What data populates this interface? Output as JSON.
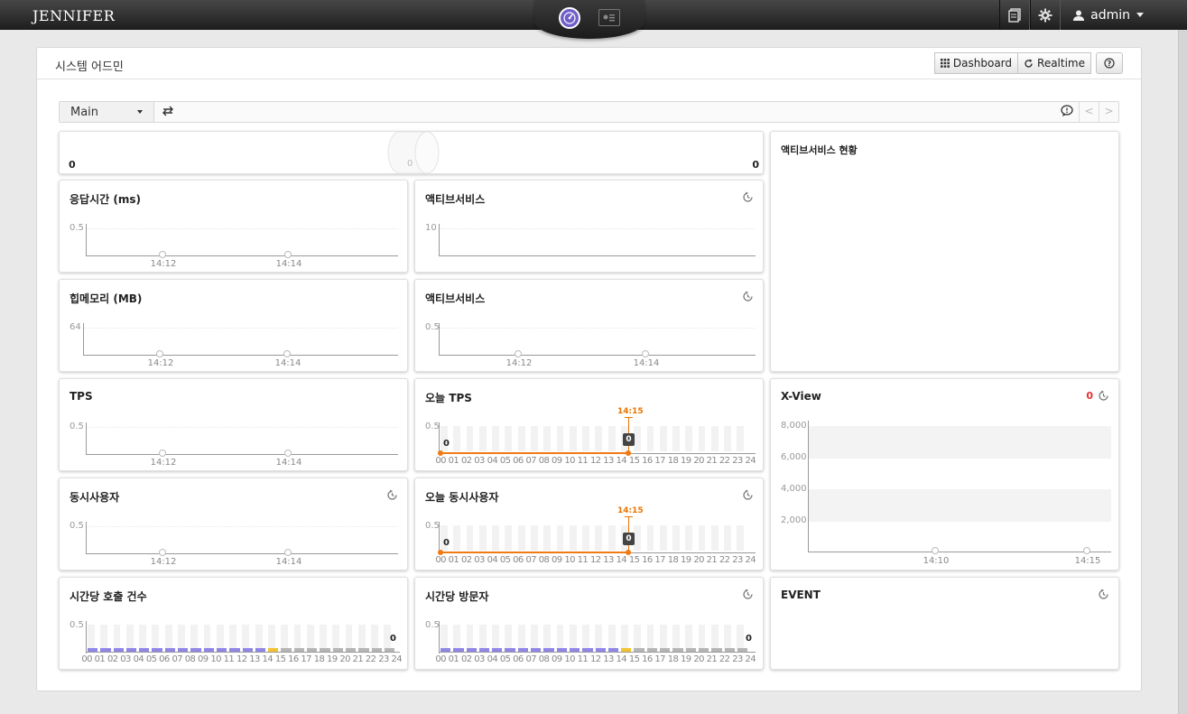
{
  "app": {
    "logo": "JENNIFER",
    "user": "admin"
  },
  "panel": {
    "title": "시스템 어드민",
    "dashboard_label": "Dashboard",
    "realtime_label": "Realtime",
    "help_label": "?"
  },
  "toolbar": {
    "selected": "Main"
  },
  "equalizer": {
    "left_value": "0",
    "right_value": "0",
    "center_value": "0"
  },
  "widgets": {
    "response_time": {
      "title": "응답시간 (ms)",
      "y_max": "0.5",
      "x_ticks": [
        "14:12",
        "14:14"
      ]
    },
    "active_service_1": {
      "title": "액티브서비스",
      "y_max": "10"
    },
    "heap_memory": {
      "title": "힙메모리 (MB)",
      "y_max": "64",
      "x_ticks": [
        "14:12",
        "14:14"
      ]
    },
    "active_service_2": {
      "title": "액티브서비스",
      "y_max": "0.5",
      "x_ticks": [
        "14:12",
        "14:14"
      ]
    },
    "tps": {
      "title": "TPS",
      "y_max": "0.5",
      "x_ticks": [
        "14:12",
        "14:14"
      ]
    },
    "today_tps": {
      "title": "오늘 TPS",
      "y_max": "0.5",
      "marker_time": "14:15",
      "marker_value": "0",
      "start_value": "0"
    },
    "concurrent_users": {
      "title": "동시사용자",
      "y_max": "0.5",
      "x_ticks": [
        "14:12",
        "14:14"
      ]
    },
    "today_concurrent_users": {
      "title": "오늘 동시사용자",
      "y_max": "0.5",
      "marker_time": "14:15",
      "marker_value": "0",
      "start_value": "0"
    },
    "hourly_calls": {
      "title": "시간당 호출 건수",
      "y_max": "0.5",
      "last_value": "0"
    },
    "hourly_visitors": {
      "title": "시간당 방문자",
      "y_max": "0.5",
      "last_value": "0"
    },
    "active_status": {
      "title": "액티브서비스 현황"
    },
    "xview": {
      "title": "X-View",
      "count": "0",
      "y_labels": [
        "8,000",
        "6,000",
        "4,000",
        "2,000"
      ],
      "x_ticks": [
        "14:10",
        "14:15"
      ]
    },
    "event": {
      "title": "EVENT"
    }
  },
  "hours": [
    "00",
    "01",
    "02",
    "03",
    "04",
    "05",
    "06",
    "07",
    "08",
    "09",
    "10",
    "11",
    "12",
    "13",
    "14",
    "15",
    "16",
    "17",
    "18",
    "19",
    "20",
    "21",
    "22",
    "23",
    "24"
  ],
  "colors": {
    "accent": "#6f5fc8",
    "orange": "#f07a14",
    "bar_past": "#8f86e6",
    "bar_now": "#f2c230",
    "bar_future": "#b5b5b5",
    "alert_red": "#e53030"
  }
}
